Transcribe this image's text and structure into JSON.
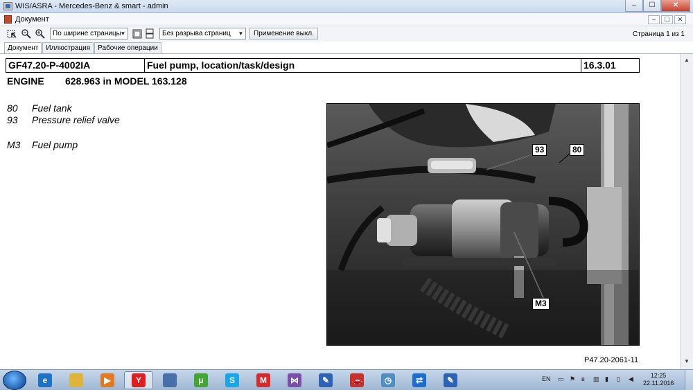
{
  "window": {
    "title": "WIS/ASRA - Mercedes-Benz & smart - admin",
    "minimize_glyph": "–",
    "maximize_glyph": "☐",
    "close_glyph": "✕"
  },
  "document_window": {
    "title": "Документ"
  },
  "toolbar": {
    "zoom_select": "По ширине страницы",
    "page_mode_select": "Без разрыва страниц",
    "apply_button": "Применение выкл.",
    "page_info": "Страница 1 из 1"
  },
  "tabs": [
    {
      "label": "Документ",
      "active": true
    },
    {
      "label": "Иллюстрация",
      "active": false
    },
    {
      "label": "Рабочие операции",
      "active": false
    }
  ],
  "doc": {
    "code": "GF47.20-P-4002IA",
    "title": "Fuel pump, location/task/design",
    "section": "16.3.01",
    "engine_label": "ENGINE",
    "engine_value": "628.963 in MODEL 163.128",
    "legend": [
      {
        "num": "80",
        "text": "Fuel tank"
      },
      {
        "num": "93",
        "text": "Pressure relief valve"
      },
      {
        "num": "M3",
        "text": "Fuel pump"
      }
    ],
    "callouts": {
      "c93": "93",
      "c80": "80",
      "cM3": "M3"
    },
    "figure_ref": "P47.20-2061-11"
  },
  "taskbar": {
    "apps": [
      {
        "name": "ie-icon",
        "color": "#1e73c8",
        "glyph": "e"
      },
      {
        "name": "explorer-icon",
        "color": "#e0b43a",
        "glyph": ""
      },
      {
        "name": "media-player-icon",
        "color": "#e07b22",
        "glyph": "▶"
      },
      {
        "name": "yandex-browser-icon",
        "color": "#e02020",
        "glyph": "Y"
      },
      {
        "name": "remote-app-icon",
        "color": "#4a6fa8",
        "glyph": ""
      },
      {
        "name": "utorrent-icon",
        "color": "#43a632",
        "glyph": "µ"
      },
      {
        "name": "skype-icon",
        "color": "#17a7e6",
        "glyph": "S"
      },
      {
        "name": "mail-agent-icon",
        "color": "#d42b2b",
        "glyph": "M"
      },
      {
        "name": "visual-studio-icon",
        "color": "#7a4fa8",
        "glyph": "⋈"
      },
      {
        "name": "wis-pen-icon",
        "color": "#2d63b5",
        "glyph": "✎"
      },
      {
        "name": "car-icon",
        "color": "#c8302a",
        "glyph": "🚗"
      },
      {
        "name": "clock-app-icon",
        "color": "#4f8fc4",
        "glyph": "◷"
      },
      {
        "name": "teamviewer-icon",
        "color": "#1d6fcf",
        "glyph": "⇄"
      },
      {
        "name": "wis-active-icon",
        "color": "#2d63b5",
        "glyph": "✎"
      }
    ],
    "language": "EN",
    "time": "12:25",
    "date": "22.11.2016"
  }
}
